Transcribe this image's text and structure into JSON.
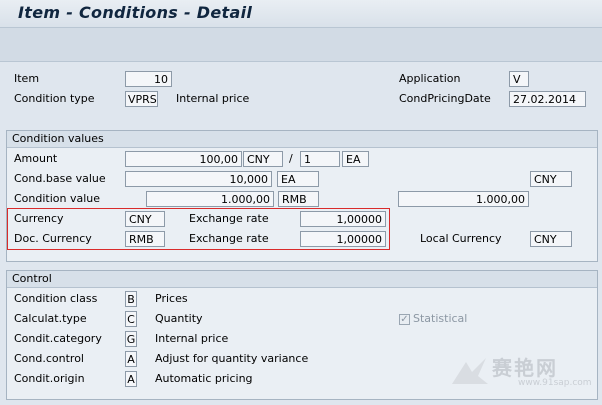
{
  "window": {
    "title": "Item - Conditions - Detail"
  },
  "header": {
    "item_label": "Item",
    "item_value": "10",
    "application_label": "Application",
    "application_value": "V",
    "condition_type_label": "Condition type",
    "condition_type_value": "VPRS",
    "condition_type_desc": "Internal price",
    "cond_pricing_date_label": "CondPricingDate",
    "cond_pricing_date_value": "27.02.2014"
  },
  "condition_values": {
    "section_title": "Condition values",
    "amount_label": "Amount",
    "amount_value": "100,00",
    "amount_currency": "CNY",
    "per_separator": "/",
    "per_value": "1",
    "per_unit": "EA",
    "cond_base_label": "Cond.base value",
    "cond_base_value": "10,000",
    "cond_base_unit": "EA",
    "cond_base_currency": "CNY",
    "condition_value_label": "Condition value",
    "condition_value_value": "1.000,00",
    "condition_value_currency": "RMB",
    "local_value": "1.000,00",
    "currency_label": "Currency",
    "currency_value": "CNY",
    "exchange_rate_label_1": "Exchange rate",
    "exchange_rate_value_1": "1,00000",
    "doc_currency_label": "Doc. Currency",
    "doc_currency_value": "RMB",
    "exchange_rate_label_2": "Exchange rate",
    "exchange_rate_value_2": "1,00000",
    "local_currency_label": "Local Currency",
    "local_currency_value": "CNY"
  },
  "control": {
    "section_title": "Control",
    "condition_class_label": "Condition class",
    "condition_class_value": "B",
    "condition_class_desc": "Prices",
    "calculat_type_label": "Calculat.type",
    "calculat_type_value": "C",
    "calculat_type_desc": "Quantity",
    "condit_category_label": "Condit.category",
    "condit_category_value": "G",
    "condit_category_desc": "Internal price",
    "cond_control_label": "Cond.control",
    "cond_control_value": "A",
    "cond_control_desc": "Adjust for quantity variance",
    "condit_origin_label": "Condit.origin",
    "condit_origin_value": "A",
    "condit_origin_desc": "Automatic pricing",
    "statistical_label": "Statistical",
    "statistical_checked": true
  },
  "watermark": {
    "brand": "赛艳网",
    "url": "www.91sap.com"
  }
}
